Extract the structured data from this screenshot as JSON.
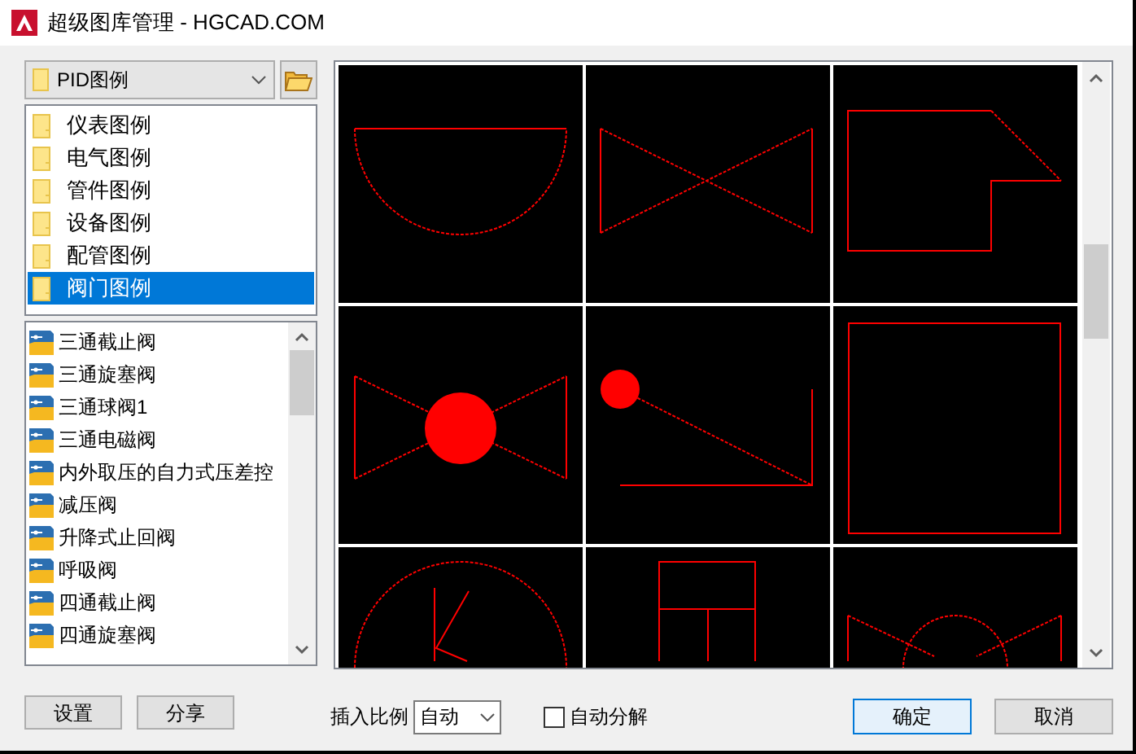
{
  "window": {
    "title": "超级图库管理 - HGCAD.COM"
  },
  "library_select": {
    "value": "PID图例"
  },
  "folders": [
    {
      "label": "仪表图例",
      "selected": false
    },
    {
      "label": "电气图例",
      "selected": false
    },
    {
      "label": "管件图例",
      "selected": false
    },
    {
      "label": "设备图例",
      "selected": false
    },
    {
      "label": "配管图例",
      "selected": false
    },
    {
      "label": "阀门图例",
      "selected": true
    }
  ],
  "symbols": [
    {
      "label": "三通截止阀"
    },
    {
      "label": "三通旋塞阀"
    },
    {
      "label": "三通球阀1"
    },
    {
      "label": "三通电磁阀"
    },
    {
      "label": "内外取压的自力式压差控"
    },
    {
      "label": "减压阀"
    },
    {
      "label": "升降式止回阀"
    },
    {
      "label": "呼吸阀"
    },
    {
      "label": "四通截止阀"
    },
    {
      "label": "四通旋塞阀"
    }
  ],
  "preview_thumbnails": [
    {
      "kind": "half-circle"
    },
    {
      "kind": "bowtie"
    },
    {
      "kind": "flag"
    },
    {
      "kind": "ball-bowtie"
    },
    {
      "kind": "lever"
    },
    {
      "kind": "square"
    },
    {
      "kind": "circle-k"
    },
    {
      "kind": "box-t"
    },
    {
      "kind": "dome-bowtie"
    }
  ],
  "left_buttons": [
    "设置",
    "分享"
  ],
  "scale": {
    "label": "插入比例",
    "value": "自动"
  },
  "auto_explode": {
    "label": "自动分解",
    "checked": false
  },
  "buttons": [
    "确定",
    "取消"
  ]
}
